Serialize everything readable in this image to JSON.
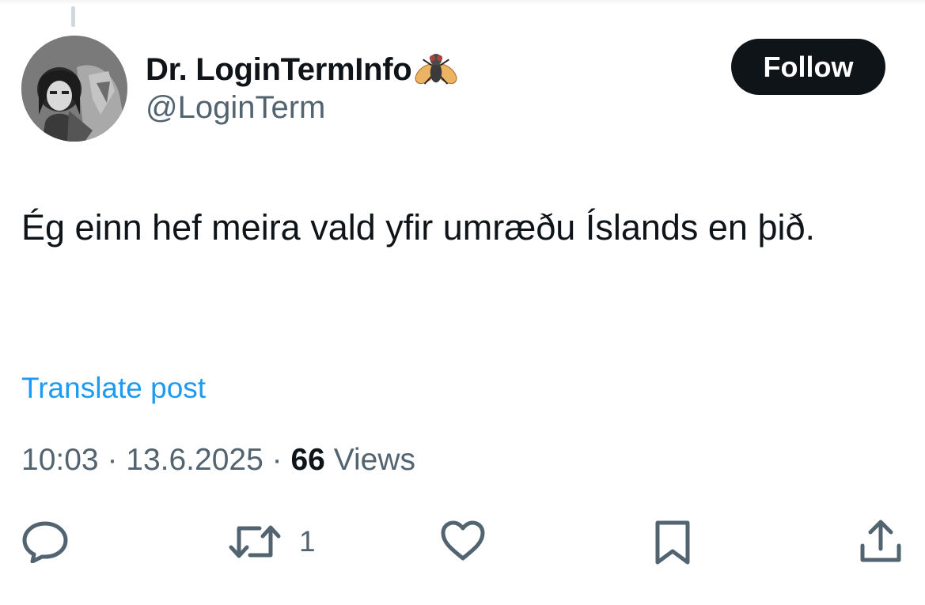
{
  "author": {
    "display_name": "Dr. LoginTermInfo",
    "name_badge_icon": "fly-emoji",
    "handle": "@LoginTerm"
  },
  "follow_button": {
    "label": "Follow"
  },
  "tweet": {
    "text": "Ég einn hef meira vald yfir umræðu Íslands en þið."
  },
  "translate_link": "Translate post",
  "meta": {
    "time": "10:03",
    "separator": " · ",
    "date": "13.6.2025",
    "views_count": "66",
    "views_label": " Views"
  },
  "actions": {
    "reply_icon": "speech-bubble-icon",
    "retweet_icon": "retweet-icon",
    "retweet_count": "1",
    "like_icon": "heart-icon",
    "bookmark_icon": "bookmark-icon",
    "share_icon": "share-icon"
  },
  "colors": {
    "text_primary": "#0f1419",
    "text_secondary": "#536471",
    "link": "#1d9bf0",
    "button_bg": "#0f1419",
    "button_text": "#ffffff"
  }
}
